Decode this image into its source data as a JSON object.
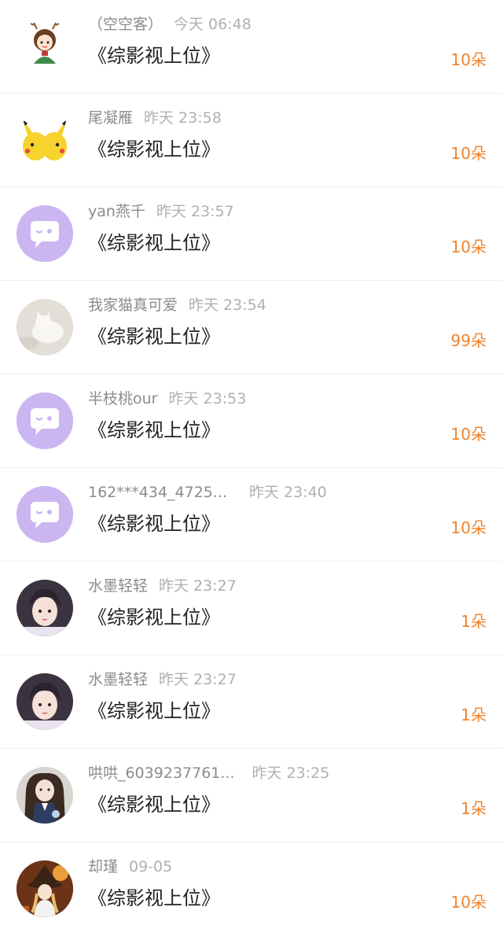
{
  "colors": {
    "count": "#f0822a",
    "name": "#8c8c8c",
    "time": "#b0b0b0",
    "title": "#222222",
    "default_avatar_bg": "#c9b5f0"
  },
  "items": [
    {
      "name": "（空空客）",
      "time": "今天 06:48",
      "title": "《综影视上位》",
      "count": "10朵",
      "avatar": "cartoon-girl-antlers"
    },
    {
      "name": "尾凝雁",
      "time": "昨天 23:58",
      "title": "《综影视上位》",
      "count": "10朵",
      "avatar": "pikachu-pair"
    },
    {
      "name": "yan燕千",
      "time": "昨天 23:57",
      "title": "《综影视上位》",
      "count": "10朵",
      "avatar": "default-chat"
    },
    {
      "name": "我家猫真可爱",
      "time": "昨天 23:54",
      "title": "《综影视上位》",
      "count": "99朵",
      "avatar": "white-cat-photo"
    },
    {
      "name": "半枝桃our",
      "time": "昨天 23:53",
      "title": "《综影视上位》",
      "count": "10朵",
      "avatar": "default-chat"
    },
    {
      "name": "162***434_4725...",
      "time": "昨天 23:40",
      "title": "《综影视上位》",
      "count": "10朵",
      "avatar": "default-chat"
    },
    {
      "name": "水墨轻轻",
      "time": "昨天 23:27",
      "title": "《综影视上位》",
      "count": "1朵",
      "avatar": "girl-portrait"
    },
    {
      "name": "水墨轻轻",
      "time": "昨天 23:27",
      "title": "《综影视上位》",
      "count": "1朵",
      "avatar": "girl-portrait"
    },
    {
      "name": "哄哄_6039237761...",
      "time": "昨天 23:25",
      "title": "《综影视上位》",
      "count": "1朵",
      "avatar": "girl-uniform-photo"
    },
    {
      "name": "却瑾",
      "time": "09-05",
      "title": "《综影视上位》",
      "count": "10朵",
      "avatar": "anime-witch"
    }
  ]
}
